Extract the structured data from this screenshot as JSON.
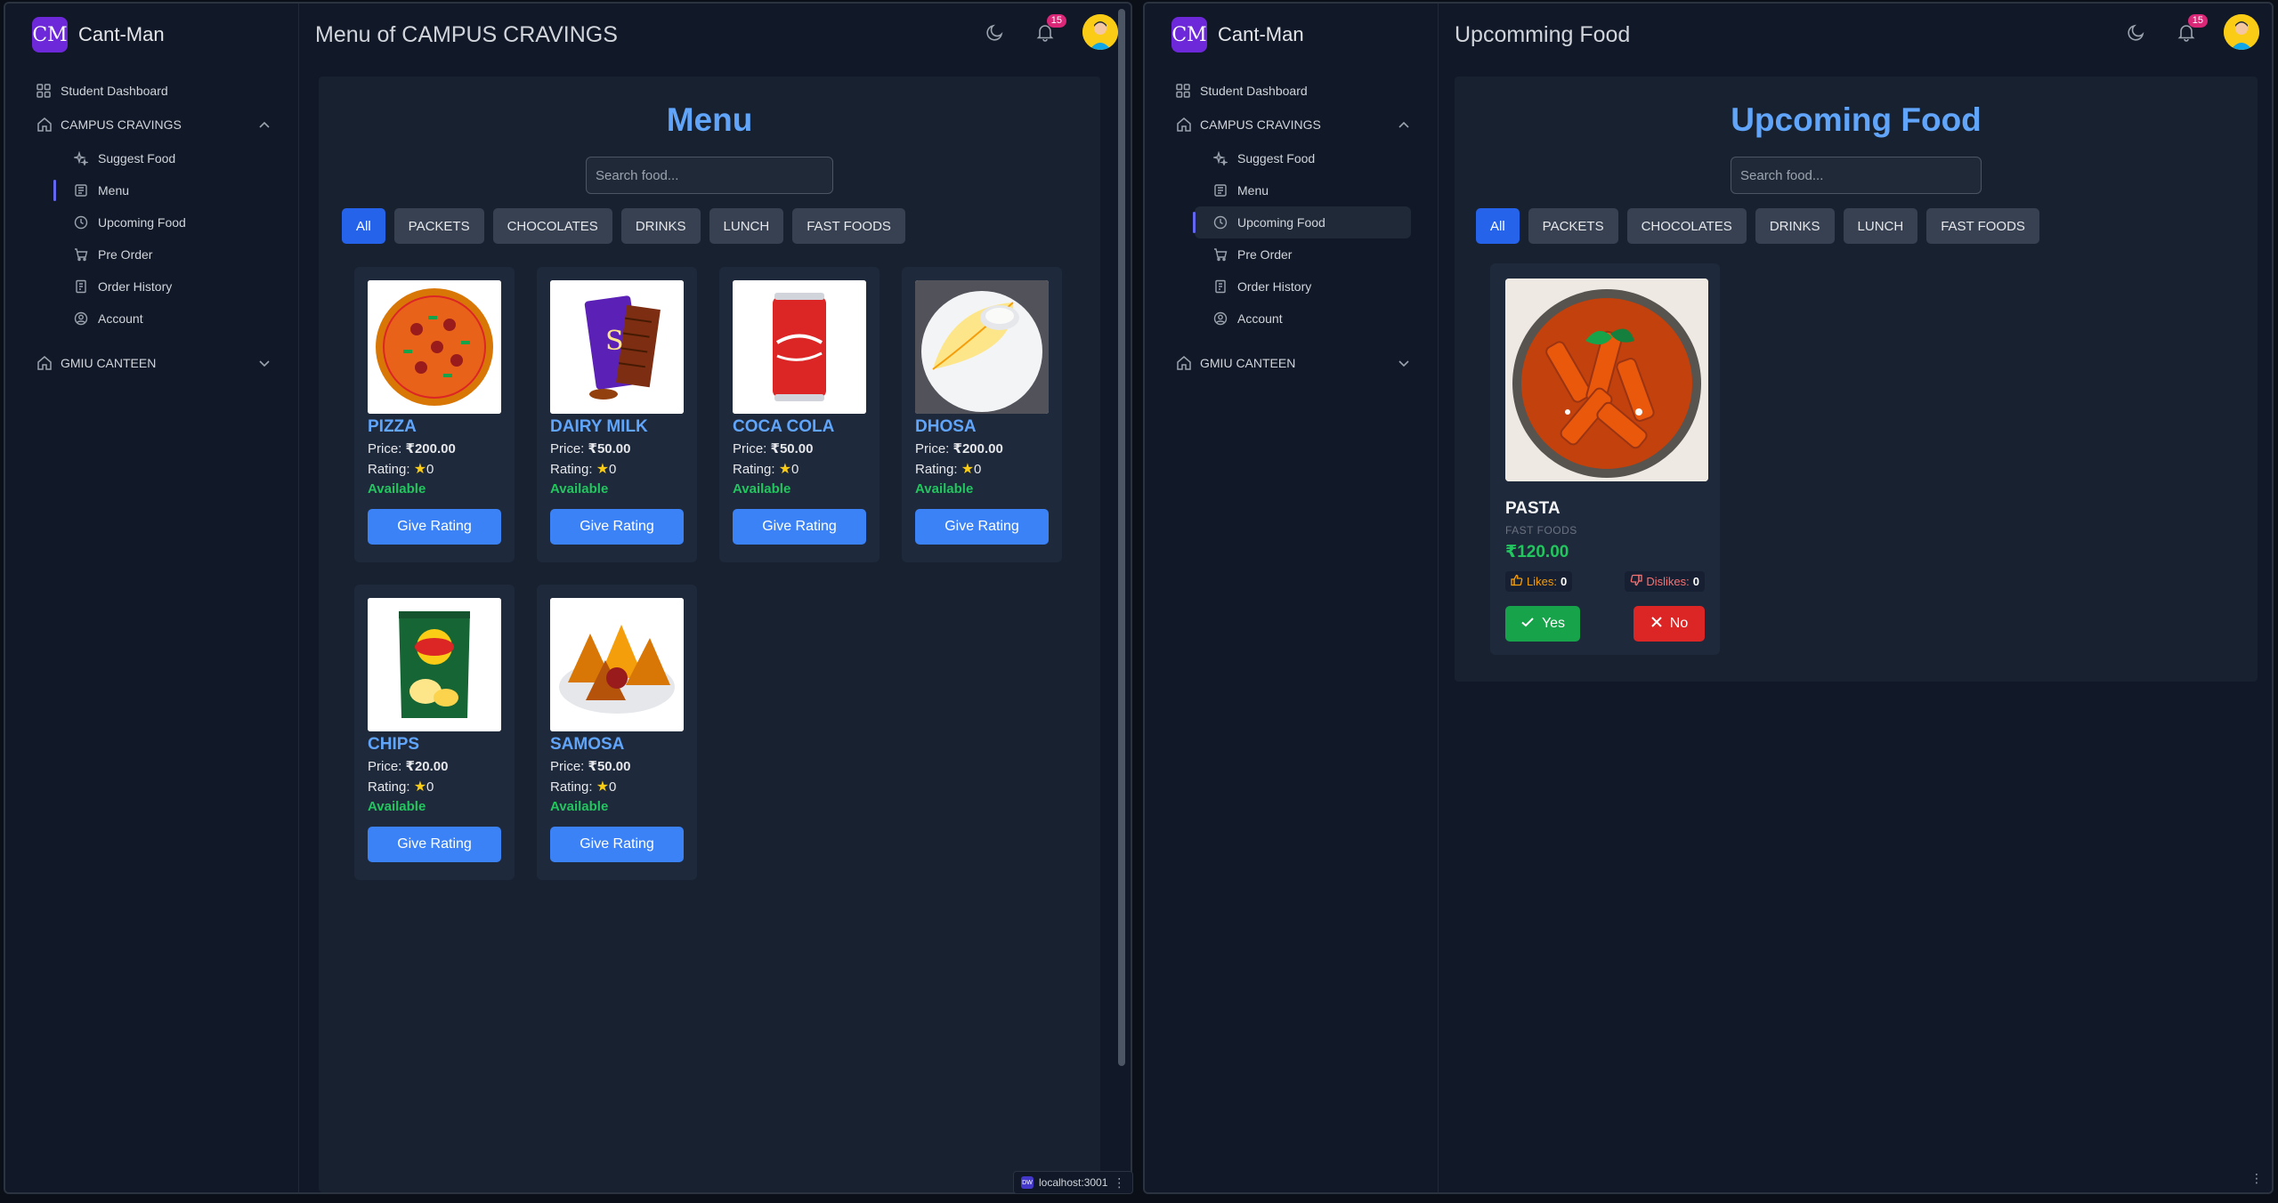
{
  "brand": {
    "logo_text": "CM",
    "name": "Cant-Man"
  },
  "left_window": {
    "title": "Menu of CAMPUS CRAVINGS",
    "notifications_count": "15",
    "sidebar": {
      "dashboard": "Student Dashboard",
      "group1": "CAMPUS CRAVINGS",
      "items": [
        "Suggest Food",
        "Menu",
        "Upcoming Food",
        "Pre Order",
        "Order History",
        "Account"
      ],
      "group2": "GMIU CANTEEN"
    },
    "content": {
      "heading": "Menu",
      "search_placeholder": "Search food...",
      "filters": [
        "All",
        "PACKETS",
        "CHOCOLATES",
        "DRINKS",
        "LUNCH",
        "FAST FOODS"
      ],
      "price_label": "Price:",
      "rating_label": "Rating:",
      "button_label": "Give Rating",
      "items": [
        {
          "name": "PIZZA",
          "price": "₹200.00",
          "rating": "0",
          "status": "Available",
          "image": "pizza"
        },
        {
          "name": "DAIRY MILK",
          "price": "₹50.00",
          "rating": "0",
          "status": "Available",
          "image": "chocolate"
        },
        {
          "name": "COCA COLA",
          "price": "₹50.00",
          "rating": "0",
          "status": "Available",
          "image": "cola-can"
        },
        {
          "name": "DHOSA",
          "price": "₹200.00",
          "rating": "0",
          "status": "Available",
          "image": "dosa"
        },
        {
          "name": "CHIPS",
          "price": "₹20.00",
          "rating": "0",
          "status": "Available",
          "image": "chips-packet"
        },
        {
          "name": "SAMOSA",
          "price": "₹50.00",
          "rating": "0",
          "status": "Available",
          "image": "samosa"
        }
      ]
    }
  },
  "right_window": {
    "title": "Upcomming Food",
    "notifications_count": "15",
    "sidebar": {
      "dashboard": "Student Dashboard",
      "group1": "CAMPUS CRAVINGS",
      "items": [
        "Suggest Food",
        "Menu",
        "Upcoming Food",
        "Pre Order",
        "Order History",
        "Account"
      ],
      "group2": "GMIU CANTEEN"
    },
    "content": {
      "heading": "Upcoming Food",
      "search_placeholder": "Search food...",
      "filters": [
        "All",
        "PACKETS",
        "CHOCOLATES",
        "DRINKS",
        "LUNCH",
        "FAST FOODS"
      ],
      "item": {
        "name": "PASTA",
        "category": "FAST FOODS",
        "price": "₹120.00",
        "likes_label": "Likes:",
        "likes": "0",
        "dislikes_label": "Dislikes:",
        "dislikes": "0",
        "yes_label": "Yes",
        "no_label": "No",
        "image": "pasta"
      }
    }
  },
  "taskbar": {
    "url": "localhost:3001",
    "logo_text": "DW"
  },
  "colors": {
    "accent": "#3b82f6",
    "heading": "#60a5fa",
    "available": "#22c55e",
    "brand": "#6d28d9",
    "badge": "#db2777"
  }
}
